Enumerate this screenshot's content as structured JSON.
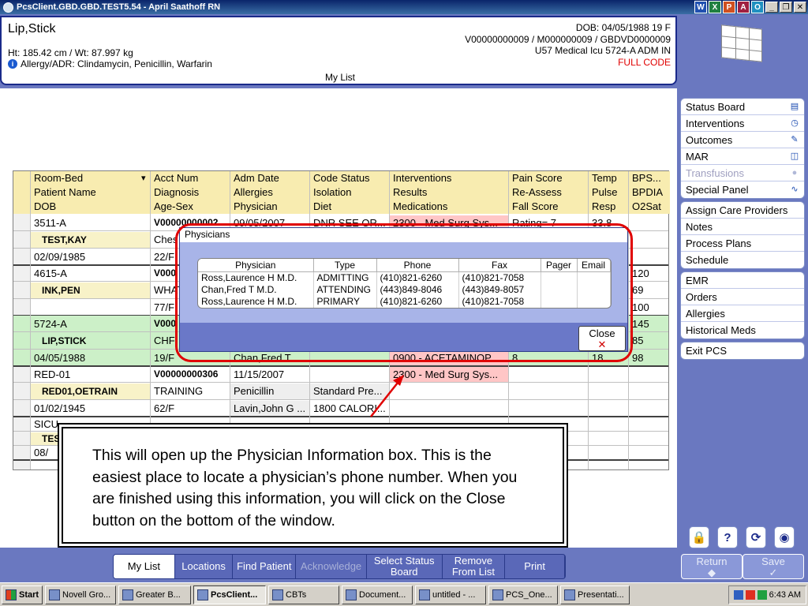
{
  "window": {
    "title": "PcsClient.GBD.GBD.TEST5.54 - April Saathoff RN"
  },
  "quicklaunch": [
    "W",
    "X",
    "P",
    "A",
    "O"
  ],
  "patient": {
    "name": "Lip,Stick",
    "dob": "DOB: 04/05/1988 19 F",
    "ids": "V00000000009 / M000000009 / GBDVD0000009",
    "location": "U57 Medical Icu  5724-A  ADM IN",
    "code_status": "FULL CODE",
    "htwt": "Ht: 185.42 cm / Wt: 87.997 kg",
    "allergy": "Allergy/ADR: Clindamycin, Penicillin, Warfarin",
    "list_name": "My List"
  },
  "grid": {
    "headers": [
      [
        "Room-Bed",
        "Acct Num",
        "Adm Date",
        "Code Status",
        "Interventions",
        "Pain Score",
        "Temp",
        "BPS..."
      ],
      [
        "Patient Name",
        "Diagnosis",
        "Allergies",
        "Isolation",
        "Results",
        "Re-Assess",
        "Pulse",
        "BPDIA"
      ],
      [
        "DOB",
        "Age-Sex",
        "Physician",
        "Diet",
        "Medications",
        "Fall Score",
        "Resp",
        "O2Sat"
      ]
    ],
    "rows": [
      [
        "3511-A",
        "V00000000002",
        "09/05/2007",
        "DNR SEE OR...",
        "2300 - Med Surg Sys...",
        "Rating= 7",
        "33.8",
        ""
      ],
      [
        "TEST,KAY",
        "Ches",
        "",
        "",
        "",
        "",
        "",
        ""
      ],
      [
        "02/09/1985",
        "22/F",
        "",
        "",
        "",
        "",
        "",
        ""
      ],
      [
        "4615-A",
        "V000",
        "",
        "",
        "",
        "",
        "",
        "120"
      ],
      [
        "INK,PEN",
        "WHAT",
        "",
        "",
        "",
        "",
        "",
        "69"
      ],
      [
        "",
        "77/F",
        "",
        "",
        "",
        "",
        "",
        "100"
      ],
      [
        "5724-A",
        "V000",
        "",
        "",
        "",
        "",
        "",
        "145"
      ],
      [
        "LIP,STICK",
        "CHF",
        "",
        "",
        "",
        "",
        "",
        "85"
      ],
      [
        "04/05/1988",
        "19/F",
        "Chan,Fred T ...",
        "",
        "0900 - ACETAMINOP...",
        "8",
        "18",
        "98"
      ],
      [
        "RED-01",
        "V00000000306",
        "11/15/2007",
        "",
        "2300 - Med Surg Sys...",
        "",
        "",
        ""
      ],
      [
        "RED01,OETRAIN",
        "TRAINING",
        "Penicillin",
        "Standard Pre...",
        "",
        "",
        "",
        ""
      ],
      [
        "01/02/1945",
        "62/F",
        "Lavin,John G ...",
        "1800 CALORI...",
        "",
        "",
        "",
        ""
      ],
      [
        "SICU",
        "",
        "",
        "",
        "",
        "",
        "",
        ""
      ],
      [
        "TES",
        "",
        "",
        "",
        "",
        "",
        "",
        ""
      ],
      [
        "08/",
        "",
        "",
        "",
        "",
        "",
        "",
        ""
      ]
    ]
  },
  "dialog": {
    "title": "Physicians",
    "columns": [
      "Physician",
      "Type",
      "Phone",
      "Fax",
      "Pager",
      "Email"
    ],
    "rows": [
      [
        "Ross,Laurence H M.D.",
        "ADMITTING",
        "(410)821-6260",
        "(410)821-7058",
        "",
        ""
      ],
      [
        "Chan,Fred T M.D.",
        "ATTENDING",
        "(443)849-8046",
        "(443)849-8057",
        "",
        ""
      ],
      [
        "Ross,Laurence H M.D.",
        "PRIMARY",
        "(410)821-6260",
        "(410)821-7058",
        "",
        ""
      ]
    ],
    "close_label": "Close"
  },
  "callout": {
    "text": "This will open up the Physician Information box. This is the easiest place to locate a physician’s phone number. When you are finished using this information, you will click on the Close button on the bottom of the window."
  },
  "right_panel": {
    "group1": [
      {
        "label": "Status Board",
        "icon": "board-icon",
        "disabled": false
      },
      {
        "label": "Interventions",
        "icon": "clock-icon",
        "disabled": false
      },
      {
        "label": "Outcomes",
        "icon": "check-icon",
        "disabled": false
      },
      {
        "label": "MAR",
        "icon": "mar-icon",
        "disabled": false
      },
      {
        "label": "Transfusions",
        "icon": "drop-icon",
        "disabled": true
      },
      {
        "label": "Special Panel",
        "icon": "wave-icon",
        "disabled": false
      }
    ],
    "group2": [
      "Assign Care Providers",
      "Notes",
      "Process Plans",
      "Schedule"
    ],
    "group3": [
      "EMR",
      "Orders",
      "Allergies",
      "Historical Meds"
    ],
    "group4": [
      "Exit PCS"
    ],
    "return_label": "Return",
    "save_label": "Save"
  },
  "tabs": [
    {
      "label": "My List",
      "active": true,
      "disabled": false
    },
    {
      "label": "Locations",
      "active": false,
      "disabled": false
    },
    {
      "label": "Find Patient",
      "active": false,
      "disabled": false
    },
    {
      "label": "Acknowledge",
      "active": false,
      "disabled": true
    },
    {
      "label": "Select Status Board",
      "active": false,
      "disabled": false
    },
    {
      "label": "Remove From List",
      "active": false,
      "disabled": false
    },
    {
      "label": "Print",
      "active": false,
      "disabled": false
    }
  ],
  "taskbar": {
    "start": "Start",
    "items": [
      "Novell Gro...",
      "Greater B...",
      "PcsClient...",
      "CBTs",
      "Document...",
      "untitled - ...",
      "PCS_One...",
      "Presentati..."
    ],
    "active_index": 2,
    "time": "6:43 AM"
  },
  "colors": {
    "accent": "#1a2a8a",
    "panel_bg": "#6a78c0",
    "header_yellow": "#f8ecb0",
    "alert_red": "#e00000",
    "selected_green": "#ccf0c8",
    "alert_pink": "#ffc6c6"
  }
}
